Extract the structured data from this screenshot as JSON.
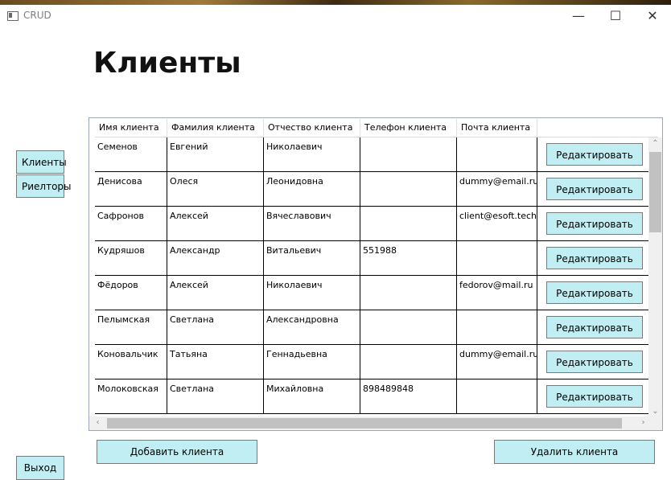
{
  "window": {
    "title": "CRUD"
  },
  "page_title": "Клиенты",
  "nav": {
    "clients_label": "Клиенты",
    "realtors_label": "Риелторы",
    "exit_label": "Выход"
  },
  "table": {
    "headers": [
      "Имя клиента",
      "Фамилия клиента",
      "Отчество клиента",
      "Телефон клиента",
      "Почта клиента"
    ],
    "edit_label": "Редактировать",
    "rows": [
      [
        "Семенов",
        "Евгений",
        "Николаевич",
        "",
        ""
      ],
      [
        "Денисова",
        "Олеся",
        "Леонидовна",
        "",
        "dummy@email.ru"
      ],
      [
        "Сафронов",
        "Алексей",
        "Вячеславович",
        "",
        "client@esoft.tech"
      ],
      [
        "Кудряшов",
        "Александр",
        "Витальевич",
        "551988",
        ""
      ],
      [
        "Фёдоров",
        "Алексей",
        "Николаевич",
        "",
        "fedorov@mail.ru"
      ],
      [
        "Пелымская",
        "Светлана",
        "Александровна",
        "",
        ""
      ],
      [
        "Коновальчик",
        "Татьяна",
        "Геннадьевна",
        "",
        "dummy@email.ru"
      ],
      [
        "Молоковская",
        "Светлана",
        "Михайловна",
        "898489848",
        ""
      ]
    ]
  },
  "actions": {
    "add_label": "Добавить клиента",
    "delete_label": "Удалить клиента"
  },
  "colors": {
    "button_bg": "#c0eef2",
    "grid_border": "#9aa8b5"
  }
}
